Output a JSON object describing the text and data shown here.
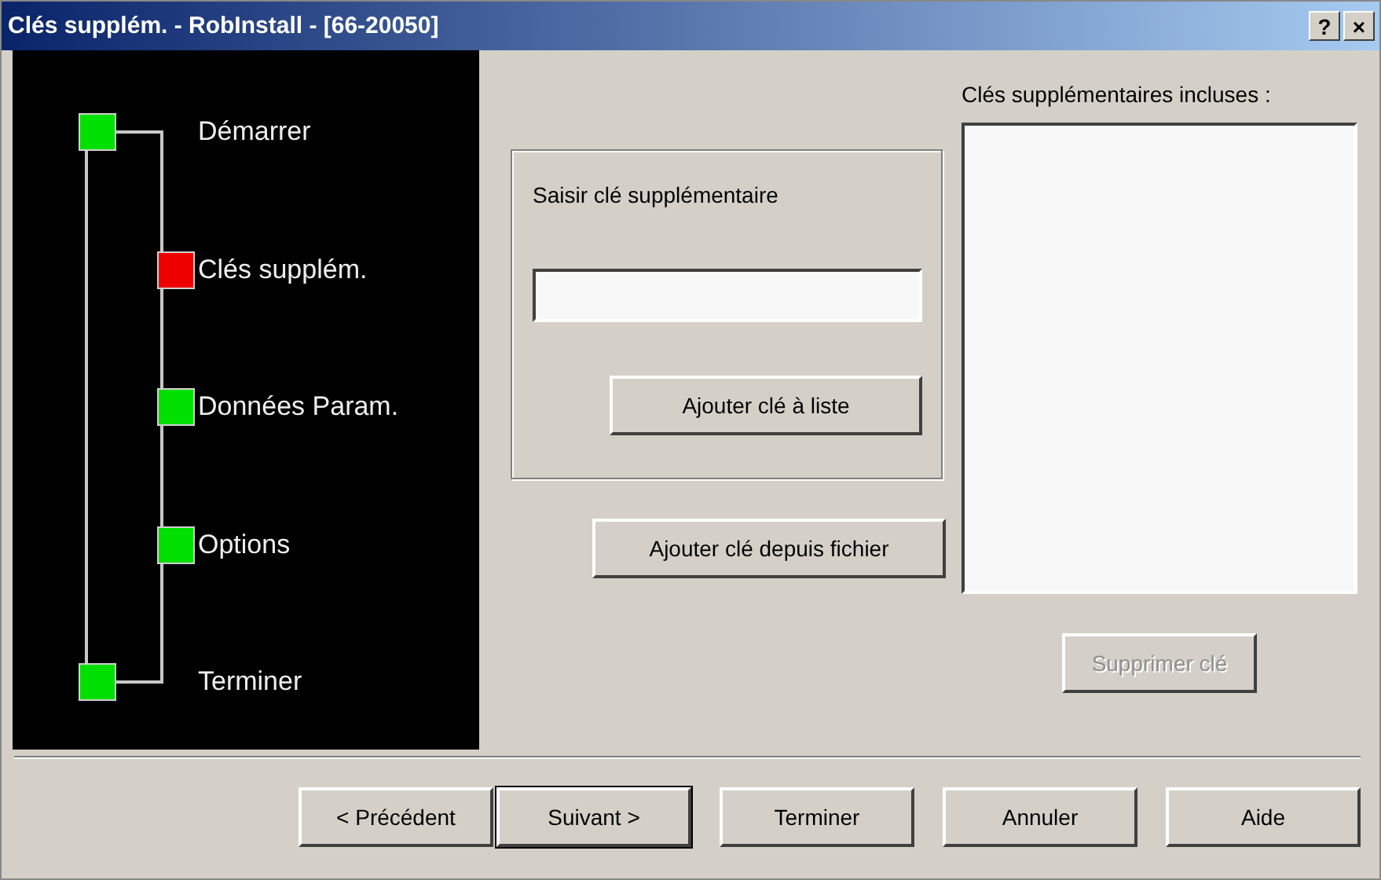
{
  "window": {
    "title": "Clés supplém. - RobInstall - [66-20050]",
    "controls": [
      "?",
      "×"
    ]
  },
  "steps": [
    {
      "label": "Démarrer",
      "kind": "endpoint",
      "selected": false
    },
    {
      "label": "Clés supplém.",
      "kind": "inner",
      "selected": true
    },
    {
      "label": "Données Param.",
      "kind": "inner",
      "selected": false
    },
    {
      "label": "Options",
      "kind": "inner",
      "selected": false
    },
    {
      "label": "Terminer",
      "kind": "endpoint",
      "selected": false
    }
  ],
  "entry_group": {
    "label": "Saisir clé supplémentaire",
    "add_button": "Ajouter clé à liste"
  },
  "file_button": "Ajouter clé depuis fichier",
  "included_list": {
    "label": "Clés supplémentaires incluses :",
    "remove_button": {
      "label": "Supprimer clé",
      "disabled": true
    }
  },
  "buttons": [
    {
      "label": "< Précédent",
      "default": false
    },
    {
      "label": "Suivant >",
      "default": true
    },
    {
      "label": "Terminer",
      "default": false
    },
    {
      "label": "Annuler",
      "default": false
    },
    {
      "label": "Aide",
      "default": false
    }
  ]
}
